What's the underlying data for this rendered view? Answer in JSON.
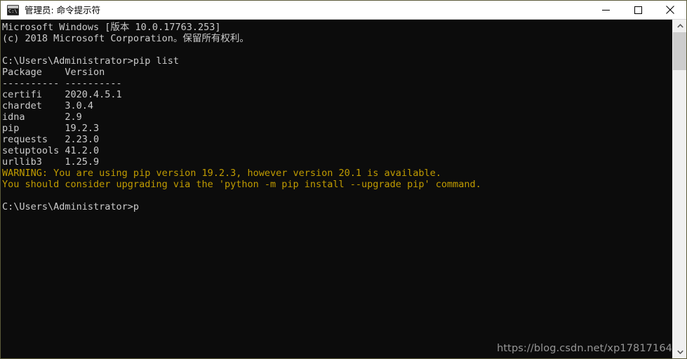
{
  "window": {
    "title": "管理员: 命令提示符",
    "icon": "cmd-console-icon",
    "icon_prompt_text": "C:\\.",
    "controls": {
      "minimize": "minimize-button",
      "maximize": "maximize-button",
      "close": "close-button"
    },
    "border_color": "#5c5b3a",
    "titlebar_bg": "#ffffff"
  },
  "terminal": {
    "background": "#0c0c0c",
    "foreground": "#cccccc",
    "warning_color": "#c19c00",
    "lines": [
      {
        "text": "Microsoft Windows [版本 10.0.17763.253]",
        "style": "normal"
      },
      {
        "text": "(c) 2018 Microsoft Corporation。保留所有权利。",
        "style": "normal"
      },
      {
        "text": "",
        "style": "blank"
      },
      {
        "text": "C:\\Users\\Administrator>pip list",
        "style": "normal"
      },
      {
        "text": "Package    Version",
        "style": "normal"
      },
      {
        "text": "---------- ----------",
        "style": "normal"
      },
      {
        "text": "certifi    2020.4.5.1",
        "style": "normal"
      },
      {
        "text": "chardet    3.0.4",
        "style": "normal"
      },
      {
        "text": "idna       2.9",
        "style": "normal"
      },
      {
        "text": "pip        19.2.3",
        "style": "normal"
      },
      {
        "text": "requests   2.23.0",
        "style": "normal"
      },
      {
        "text": "setuptools 41.2.0",
        "style": "normal"
      },
      {
        "text": "urllib3    1.25.9",
        "style": "normal"
      },
      {
        "text": "WARNING: You are using pip version 19.2.3, however version 20.1 is available.",
        "style": "warn"
      },
      {
        "text": "You should consider upgrading via the 'python -m pip install --upgrade pip' command.",
        "style": "warn"
      },
      {
        "text": "",
        "style": "blank"
      },
      {
        "text": "C:\\Users\\Administrator>p",
        "style": "normal"
      }
    ],
    "command": "pip list",
    "prompt": "C:\\Users\\Administrator>",
    "typed_input": "p",
    "package_table": {
      "headers": [
        "Package",
        "Version"
      ],
      "separator": "---------- ----------",
      "rows": [
        [
          "certifi",
          "2020.4.5.1"
        ],
        [
          "chardet",
          "3.0.4"
        ],
        [
          "idna",
          "2.9"
        ],
        [
          "pip",
          "19.2.3"
        ],
        [
          "requests",
          "2.23.0"
        ],
        [
          "setuptools",
          "41.2.0"
        ],
        [
          "urllib3",
          "1.25.9"
        ]
      ]
    }
  },
  "watermark": {
    "text": "https://blog.csdn.net/xp17817164"
  },
  "scrollbar": {
    "up_arrow": "scroll-up-arrow-icon",
    "down_arrow": "scroll-down-arrow-icon",
    "track_color": "#f0f0f0",
    "thumb_color": "#cdcdcd"
  }
}
